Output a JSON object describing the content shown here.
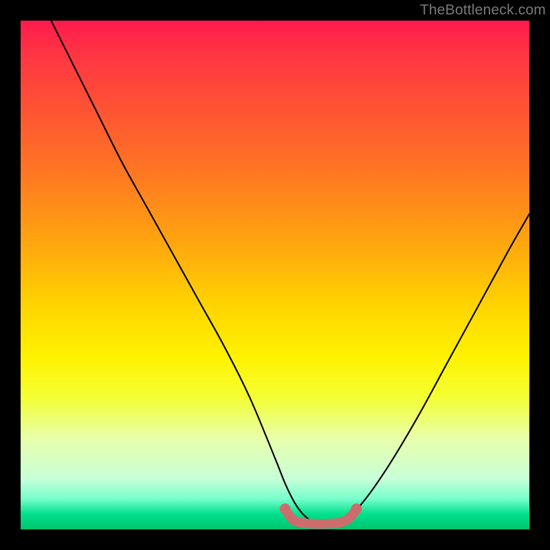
{
  "watermark": {
    "text": "TheBottleneck.com"
  },
  "chart_data": {
    "type": "line",
    "title": "",
    "xlabel": "",
    "ylabel": "",
    "xlim": [
      0,
      100
    ],
    "ylim": [
      0,
      100
    ],
    "legend": null,
    "gradient_meaning": "vertical color band from red (high/bad) at top to green (low/good) at bottom",
    "series": [
      {
        "name": "bottleneck-curve",
        "stroke": "#000000",
        "x": [
          6,
          10,
          15,
          20,
          25,
          30,
          35,
          40,
          45,
          50,
          52,
          54,
          56,
          58,
          60,
          62,
          64,
          67,
          72,
          78,
          84,
          90,
          96,
          100
        ],
        "y": [
          100,
          92,
          82,
          72,
          63,
          54,
          45,
          36,
          26,
          14,
          9,
          5,
          2.5,
          1.4,
          1.2,
          1.4,
          2.5,
          5,
          12,
          22,
          33,
          44,
          55,
          62
        ]
      },
      {
        "name": "optimal-band",
        "stroke": "#cc6d6d",
        "fill": "#cc6d6d",
        "style": "thick rounded caps marking flat valley floor",
        "x": [
          52,
          53,
          54,
          56,
          58,
          60,
          62,
          63,
          64,
          65,
          66
        ],
        "y": [
          4.0,
          2.5,
          1.6,
          1.2,
          1.1,
          1.1,
          1.2,
          1.4,
          1.8,
          2.6,
          4.0
        ]
      }
    ]
  }
}
